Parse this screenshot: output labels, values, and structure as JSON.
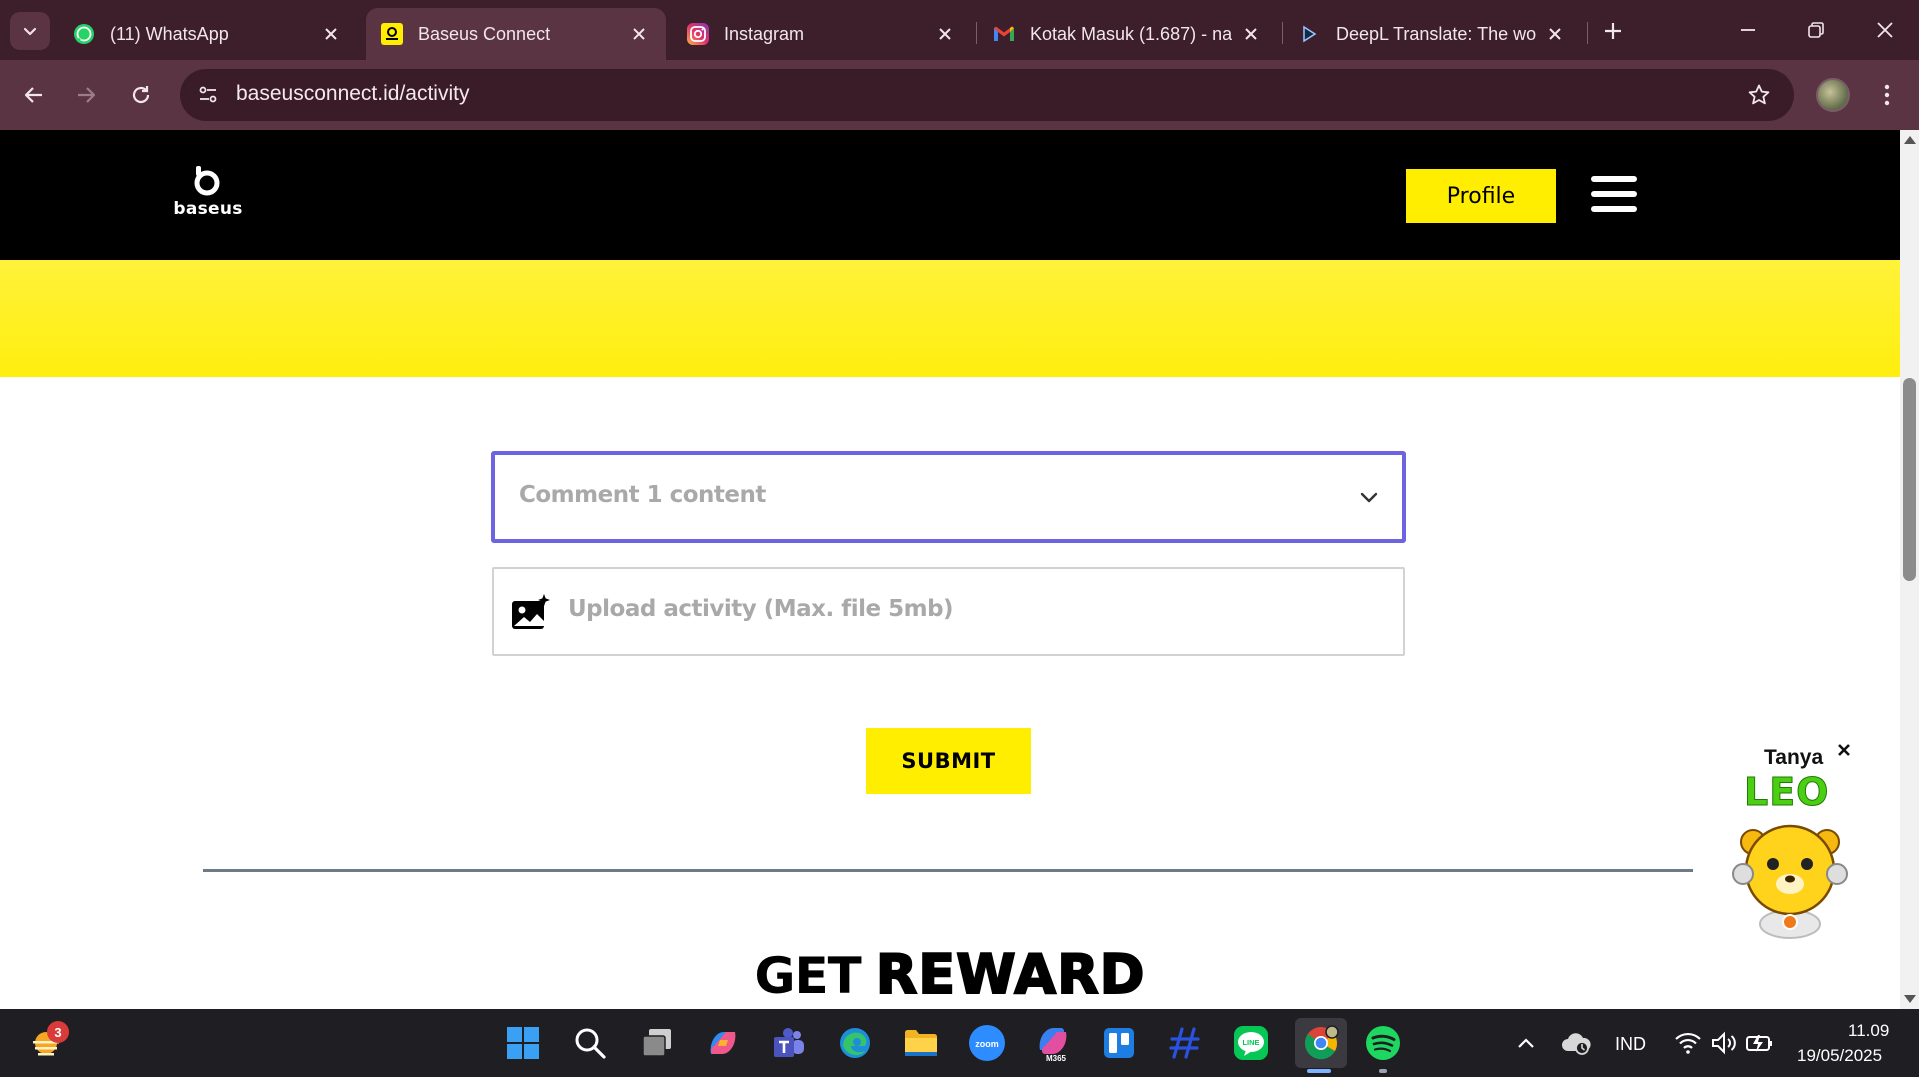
{
  "browser": {
    "tabs": [
      {
        "title": "(11) WhatsApp",
        "icon": "whatsapp-icon",
        "active": false
      },
      {
        "title": "Baseus Connect",
        "icon": "baseus-favicon",
        "active": true
      },
      {
        "title": "Instagram",
        "icon": "instagram-icon",
        "active": false
      },
      {
        "title": "Kotak Masuk (1.687) - na",
        "icon": "gmail-icon",
        "active": false
      },
      {
        "title": "DeepL Translate: The wor",
        "icon": "deepl-icon",
        "active": false
      }
    ],
    "url": "baseusconnect.id/activity"
  },
  "site": {
    "logo_text": "baseus",
    "profile_label": "Profile",
    "colors": {
      "brand_yellow": "#ffee00",
      "header_bg": "#000000",
      "focus_border": "#6d63e3"
    }
  },
  "form": {
    "comment_select": {
      "value": "Comment 1 content"
    },
    "upload": {
      "label": "Upload activity (Max. file 5mb)"
    },
    "submit_label": "SUBMIT"
  },
  "reward": {
    "word1": "GET",
    "word2": "REWARD"
  },
  "chat_widget": {
    "prompt": "Tanya",
    "name": "LEO"
  },
  "taskbar": {
    "weather_badge": "3",
    "apps": [
      "start-icon",
      "search-icon",
      "task-view-icon",
      "copilot-icon",
      "teams-icon",
      "edge-icon",
      "file-explorer-icon",
      "zoom-icon",
      "m365-icon",
      "trello-icon",
      "dash-app-icon",
      "line-icon",
      "chrome-icon",
      "spotify-icon"
    ],
    "m365_label": "M365",
    "zoom_label": "zoom",
    "line_label": "LINE",
    "language": "IND",
    "time": "11.09",
    "date": "19/05/2025"
  }
}
